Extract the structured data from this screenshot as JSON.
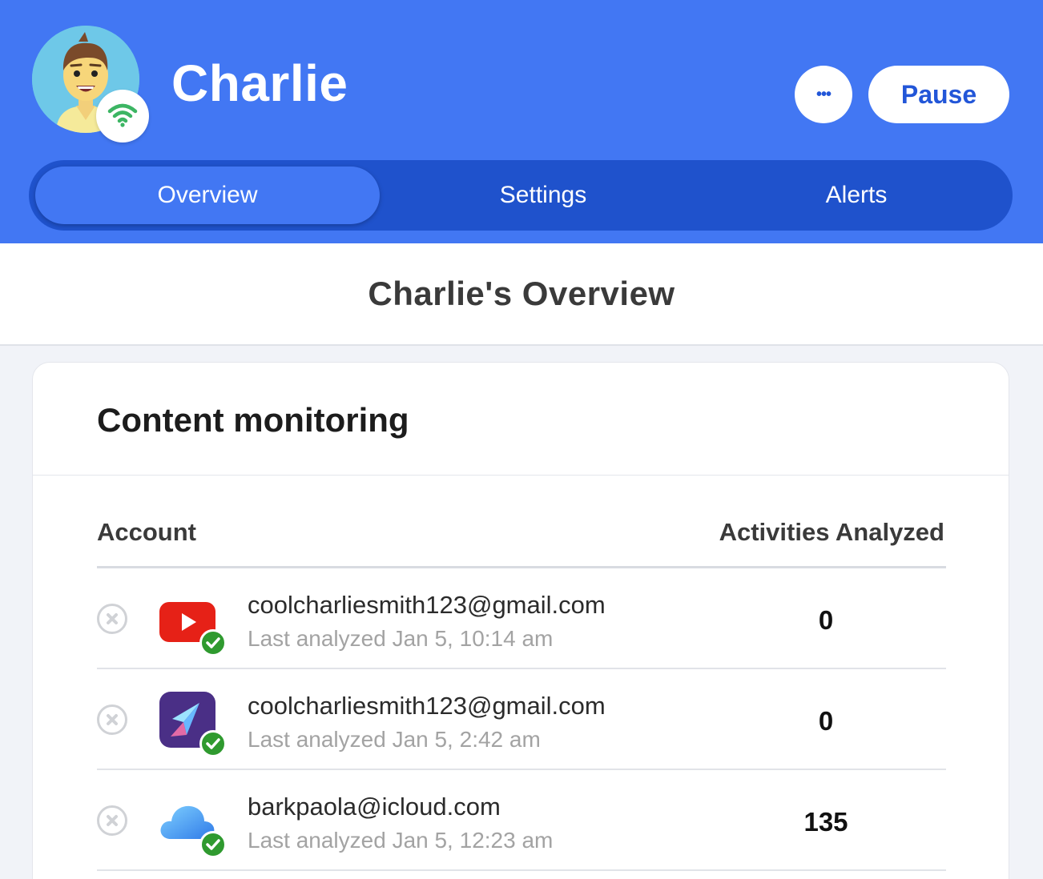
{
  "header": {
    "child_name": "Charlie",
    "more_label": "•••",
    "pause_label": "Pause",
    "brand_color": "#4277f3",
    "tabbar_color": "#1f52cc"
  },
  "tabs": [
    {
      "label": "Overview",
      "active": true
    },
    {
      "label": "Settings",
      "active": false
    },
    {
      "label": "Alerts",
      "active": false
    }
  ],
  "page_title": "Charlie's Overview",
  "content_monitoring": {
    "title": "Content monitoring",
    "columns": {
      "account": "Account",
      "activities": "Activities Analyzed"
    },
    "rows": [
      {
        "icon": "youtube-icon",
        "email": "coolcharliesmith123@gmail.com",
        "last_analyzed": "Last analyzed Jan 5, 10:14 am",
        "count": "0"
      },
      {
        "icon": "app-arrow-icon",
        "email": "coolcharliesmith123@gmail.com",
        "last_analyzed": "Last analyzed Jan 5, 2:42 am",
        "count": "0"
      },
      {
        "icon": "icloud-icon",
        "email": "barkpaola@icloud.com",
        "last_analyzed": "Last analyzed Jan 5, 12:23 am",
        "count": "135"
      }
    ]
  },
  "status_icons": {
    "connected": "wifi-icon",
    "verified": "check-icon",
    "remove": "remove-icon"
  }
}
